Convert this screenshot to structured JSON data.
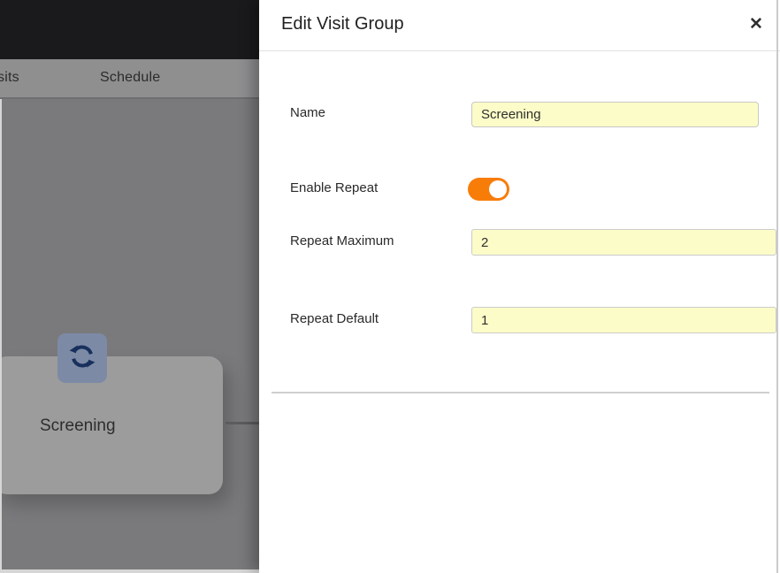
{
  "app": {
    "tabs": [
      {
        "label": "sits"
      },
      {
        "label": "Schedule"
      }
    ],
    "canvas": {
      "group_card": {
        "label": "Screening",
        "icon": "sync-icon"
      }
    }
  },
  "drawer": {
    "title": "Edit Visit Group",
    "close_glyph": "✕",
    "fields": {
      "name": {
        "label": "Name",
        "value": "Screening"
      },
      "enable_repeat": {
        "label": "Enable Repeat",
        "state": "on"
      },
      "repeat_maximum": {
        "label": "Repeat Maximum",
        "value": "2"
      },
      "repeat_default": {
        "label": "Repeat Default",
        "value": "1"
      }
    }
  },
  "colors": {
    "accent_orange": "#f87c08",
    "input_background": "#fcfcc8",
    "backdrop_gray": "#7a7a7c",
    "topbar_black": "#1a1a1c",
    "badge_blue": "#7d8aa6",
    "icon_navy": "#17305c"
  }
}
